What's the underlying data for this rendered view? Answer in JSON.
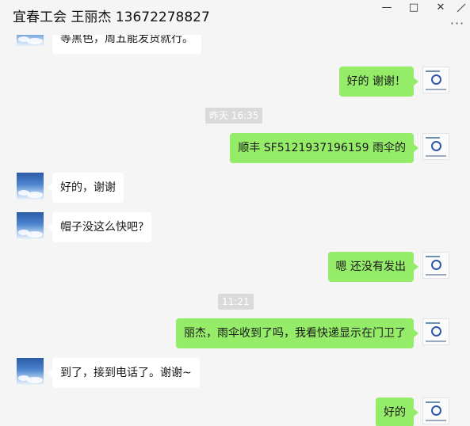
{
  "window": {
    "title": "宜春工会 王丽杰 13672278827",
    "minimize_glyph": "—",
    "maximize_glyph": "□",
    "close_glyph": "✕",
    "menu_glyph": "···"
  },
  "messages": [
    {
      "side": "in",
      "text": "等黑色，周五能发货就行。"
    },
    {
      "side": "out",
      "text": "好的  谢谢！"
    },
    {
      "type": "time",
      "text": "昨天 16:35"
    },
    {
      "side": "out",
      "text": "顺丰 SF5121937196159   雨伞的"
    },
    {
      "side": "in",
      "text": "好的，谢谢"
    },
    {
      "side": "in",
      "text": "帽子没这么快吧?"
    },
    {
      "side": "out",
      "text": "嗯 还没有发出"
    },
    {
      "type": "time",
      "text": "11:21"
    },
    {
      "side": "out",
      "text": "丽杰，雨伞收到了吗，我看快递显示在门卫了"
    },
    {
      "side": "in",
      "text": "到了，接到电话了。谢谢~"
    },
    {
      "side": "out",
      "text": "好的"
    }
  ],
  "colors": {
    "background": "#f5f5f5",
    "incoming_bubble": "#ffffff",
    "outgoing_bubble": "#95ec69",
    "timestamp_bg": "#dadada"
  }
}
